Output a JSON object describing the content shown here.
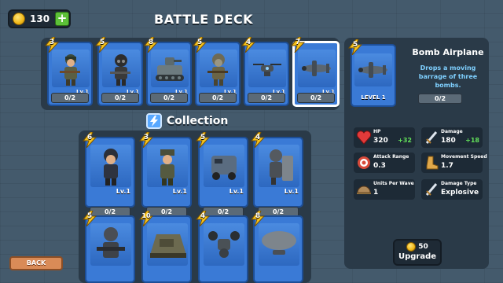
{
  "currency": {
    "coins": "130",
    "add_label": "+"
  },
  "deck": {
    "title": "BATTLE DECK",
    "cards": [
      {
        "name": "rifleman",
        "cost": "3",
        "level": "Lv.1",
        "progress": "0/2"
      },
      {
        "name": "gas-soldier",
        "cost": "5",
        "level": "Lv.1",
        "progress": "0/2"
      },
      {
        "name": "tank",
        "cost": "8",
        "level": "Lv.1",
        "progress": "0/2"
      },
      {
        "name": "gas-mask-trooper",
        "cost": "5",
        "level": "Lv.1",
        "progress": "0/2"
      },
      {
        "name": "drone",
        "cost": "4",
        "level": "Lv.1",
        "progress": "0/2"
      },
      {
        "name": "bomb-airplane",
        "cost": "7",
        "level": "Lv.1",
        "progress": "0/2"
      }
    ]
  },
  "collection": {
    "title": "Collection",
    "cards": [
      {
        "name": "helmet-soldier",
        "cost": "6",
        "level": "Lv.1",
        "progress": "0/2"
      },
      {
        "name": "officer",
        "cost": "3",
        "level": "Lv.1",
        "progress": "0/2"
      },
      {
        "name": "armored-car",
        "cost": "5",
        "level": "Lv.1",
        "progress": "0/2"
      },
      {
        "name": "shield-knight",
        "cost": "4",
        "level": "Lv.1",
        "progress": "0/2"
      },
      {
        "name": "heavy-gunner",
        "cost": "5",
        "level": "",
        "progress": ""
      },
      {
        "name": "heavy-tank",
        "cost": "10",
        "level": "",
        "progress": ""
      },
      {
        "name": "quad-drone",
        "cost": "4",
        "level": "",
        "progress": ""
      },
      {
        "name": "airship",
        "cost": "8",
        "level": "",
        "progress": ""
      }
    ]
  },
  "selected_unit": {
    "cost": "5",
    "name": "Bomb Airplane",
    "description": "Drops a moving barrage of three bombs.",
    "level_label": "LEVEL 1",
    "progress": "0/2",
    "stats": {
      "hp": {
        "label": "HP",
        "value": "320",
        "bonus": "+32",
        "icon": "heart-icon"
      },
      "damage": {
        "label": "Damage",
        "value": "180",
        "bonus": "+18",
        "icon": "sword-icon"
      },
      "attack_range": {
        "label": "Attack Range",
        "value": "0.3",
        "icon": "target-icon"
      },
      "movement_speed": {
        "label": "Movement Speed",
        "value": "1.7",
        "icon": "boot-icon"
      },
      "units_per_wave": {
        "label": "Units Per Wave",
        "value": "1",
        "icon": "helmet-icon"
      },
      "damage_type": {
        "label": "Damage Type",
        "value": "Explosive",
        "icon": "sword-icon"
      }
    },
    "upgrade": {
      "cost": "50",
      "label": "Upgrade"
    }
  },
  "back_label": "BACK",
  "colors": {
    "card_blue": "#3a7ad6",
    "bonus_green": "#62e05a",
    "desc_blue": "#7fd0ff",
    "panel": "#2a3a48"
  }
}
